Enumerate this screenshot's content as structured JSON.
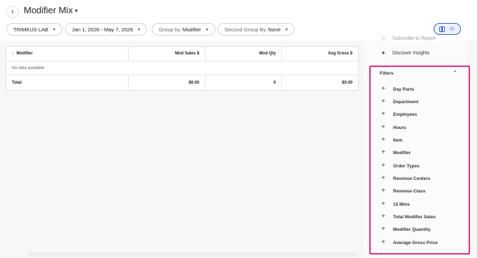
{
  "header": {
    "title": "Modifier Mix",
    "back_icon": "chevron-left-icon"
  },
  "toolbar": {
    "location": "TRIMKUS LAB",
    "date_range": "Jan 1, 2026 - May 7, 2026",
    "group_by_label": "Group by",
    "group_by_value": "Modifier",
    "second_group_label": "Second Group By",
    "second_group_value": "None",
    "panel_count": "0"
  },
  "table": {
    "columns": [
      "Modifier",
      "Mod Sales $",
      "Mod Qty",
      "Avg Gross $"
    ],
    "empty_text": "No data available",
    "total_row": [
      "Total",
      "$0.00",
      "0",
      "$0.00"
    ]
  },
  "sidebar": {
    "subscribe_label": "Subscribe to Report",
    "discover_label": "Discover Insights",
    "filters_title": "Filters",
    "filters": [
      "Day Parts",
      "Department",
      "Employees",
      "Hours",
      "Item",
      "Modifier",
      "Order Types",
      "Revenue Centers",
      "Revenue Class",
      "15 Mins",
      "Total Modifier Sales",
      "Modifier Quantity",
      "Average Gross Price"
    ]
  },
  "colors": {
    "accent": "#2c5fe6",
    "highlight_border": "#f0277c"
  }
}
